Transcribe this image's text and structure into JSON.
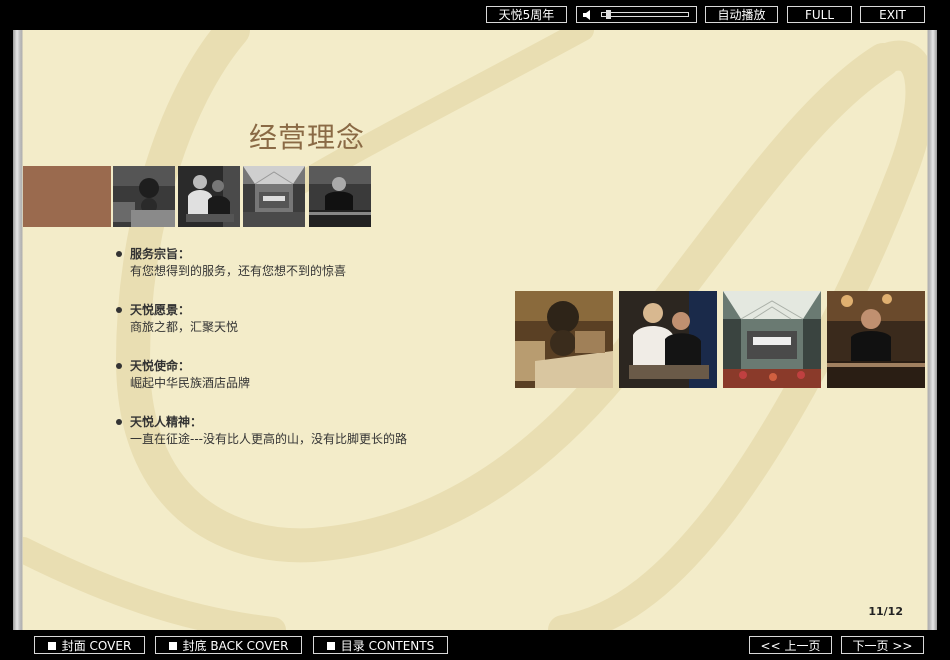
{
  "toolbar": {
    "anniversary_label": "天悦5周年",
    "autoplay_label": "自动播放",
    "full_label": "FULL",
    "exit_label": "EXIT",
    "volume_level": 0.05
  },
  "page": {
    "title": "经营理念",
    "bullets": [
      {
        "heading": "服务宗旨：",
        "text": "有您想得到的服务，还有您想不到的惊喜"
      },
      {
        "heading": "天悦愿景：",
        "text": "商旅之都，汇聚天悦"
      },
      {
        "heading": "天悦使命：",
        "text": "崛起中华民族酒店品牌"
      },
      {
        "heading": "天悦人精神：",
        "text": "一直在征途---没有比人更高的山，没有比脚更长的路"
      }
    ],
    "page_number": "11/12"
  },
  "footer": {
    "cover_label": "封面 COVER",
    "back_cover_label": "封底 BACK COVER",
    "contents_label": "目录 CONTENTS",
    "prev_label": "<< 上一页",
    "next_label": "下一页 >>"
  },
  "colors": {
    "page_bg": "#f3ecc9",
    "title": "#8a6a45",
    "accent_bar": "#9a6a4e"
  }
}
